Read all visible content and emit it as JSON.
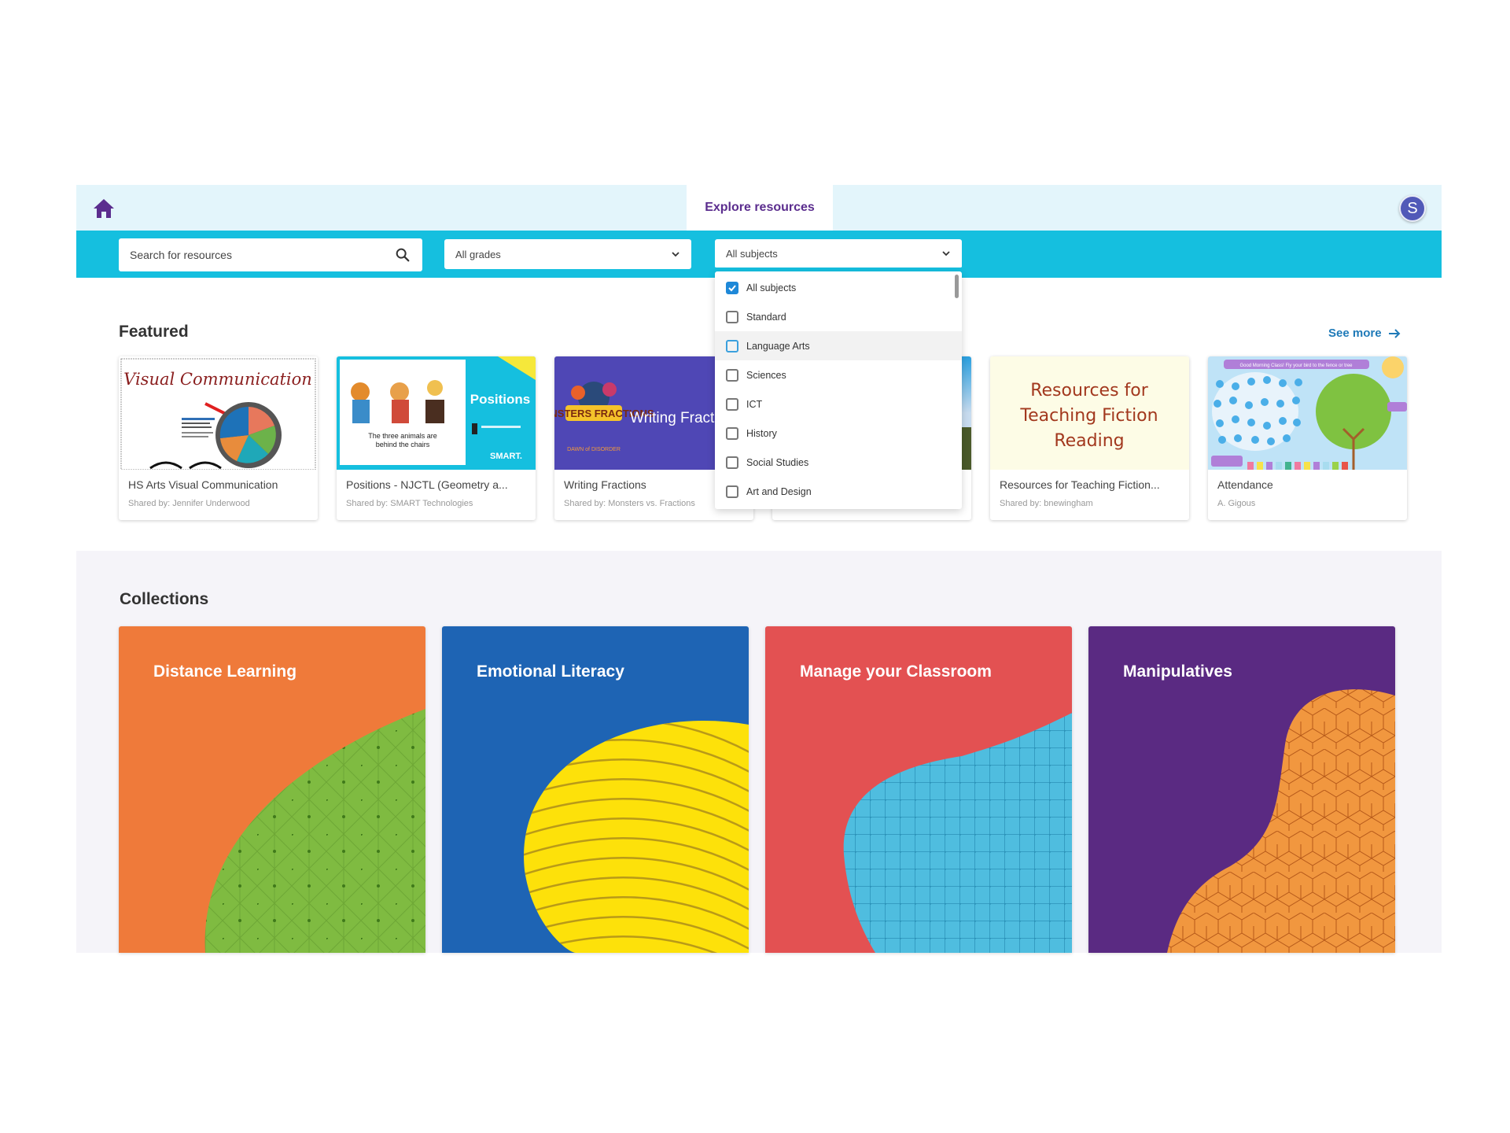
{
  "topbar": {
    "home_icon": "home-icon",
    "active_tab": "Explore resources",
    "avatar_initial": "S"
  },
  "filters": {
    "search_placeholder": "Search for resources",
    "search_icon": "search-icon",
    "grades_value": "All grades",
    "subjects_value": "All subjects"
  },
  "subjects_dropdown": {
    "options": [
      {
        "label": "All subjects",
        "checked": true
      },
      {
        "label": "Standard",
        "checked": false
      },
      {
        "label": "Language Arts",
        "checked": false
      },
      {
        "label": "Sciences",
        "checked": false
      },
      {
        "label": "ICT",
        "checked": false
      },
      {
        "label": "History",
        "checked": false
      },
      {
        "label": "Social Studies",
        "checked": false
      },
      {
        "label": "Art and Design",
        "checked": false
      }
    ]
  },
  "featured": {
    "title": "Featured",
    "see_more": "See more",
    "cards": [
      {
        "title": "HS Arts Visual Communication",
        "subtitle": "Shared by: Jennifer Underwood",
        "thumb_text": "Visual Communication"
      },
      {
        "title": "Positions - NJCTL (Geometry a...",
        "subtitle": "Shared by: SMART Technologies",
        "thumb_text": "Positions",
        "thumb_caption": "The three animals are behind the chairs",
        "thumb_brand": "SMART."
      },
      {
        "title": "Writing Fractions",
        "subtitle": "Shared by: Monsters vs. Fractions",
        "thumb_text": "Writing Fract",
        "thumb_logo": "MONSTERS FRACTIONS",
        "thumb_episode": "DAWN of DISORDER"
      },
      {
        "title": "",
        "subtitle": ""
      },
      {
        "title": "Resources for Teaching Fiction...",
        "subtitle": "Shared by: bnewingham",
        "thumb_lines": [
          "Resources for",
          "Teaching Fiction",
          "Reading"
        ]
      },
      {
        "title": "Attendance",
        "subtitle": "A. Gigous",
        "thumb_banner": "Good Morning Class! Fly your bird to the fence or tree"
      }
    ]
  },
  "collections": {
    "title": "Collections",
    "items": [
      {
        "label": "Distance Learning",
        "bg": "#ef7a3a",
        "accent": "#7fbb41"
      },
      {
        "label": "Emotional Literacy",
        "bg": "#1e64b4",
        "accent": "#fde10a"
      },
      {
        "label": "Manage your Classroom",
        "bg": "#e35152",
        "accent": "#4fbddf"
      },
      {
        "label": "Manipulatives",
        "bg": "#5a2a82",
        "accent": "#f1973f"
      }
    ]
  }
}
